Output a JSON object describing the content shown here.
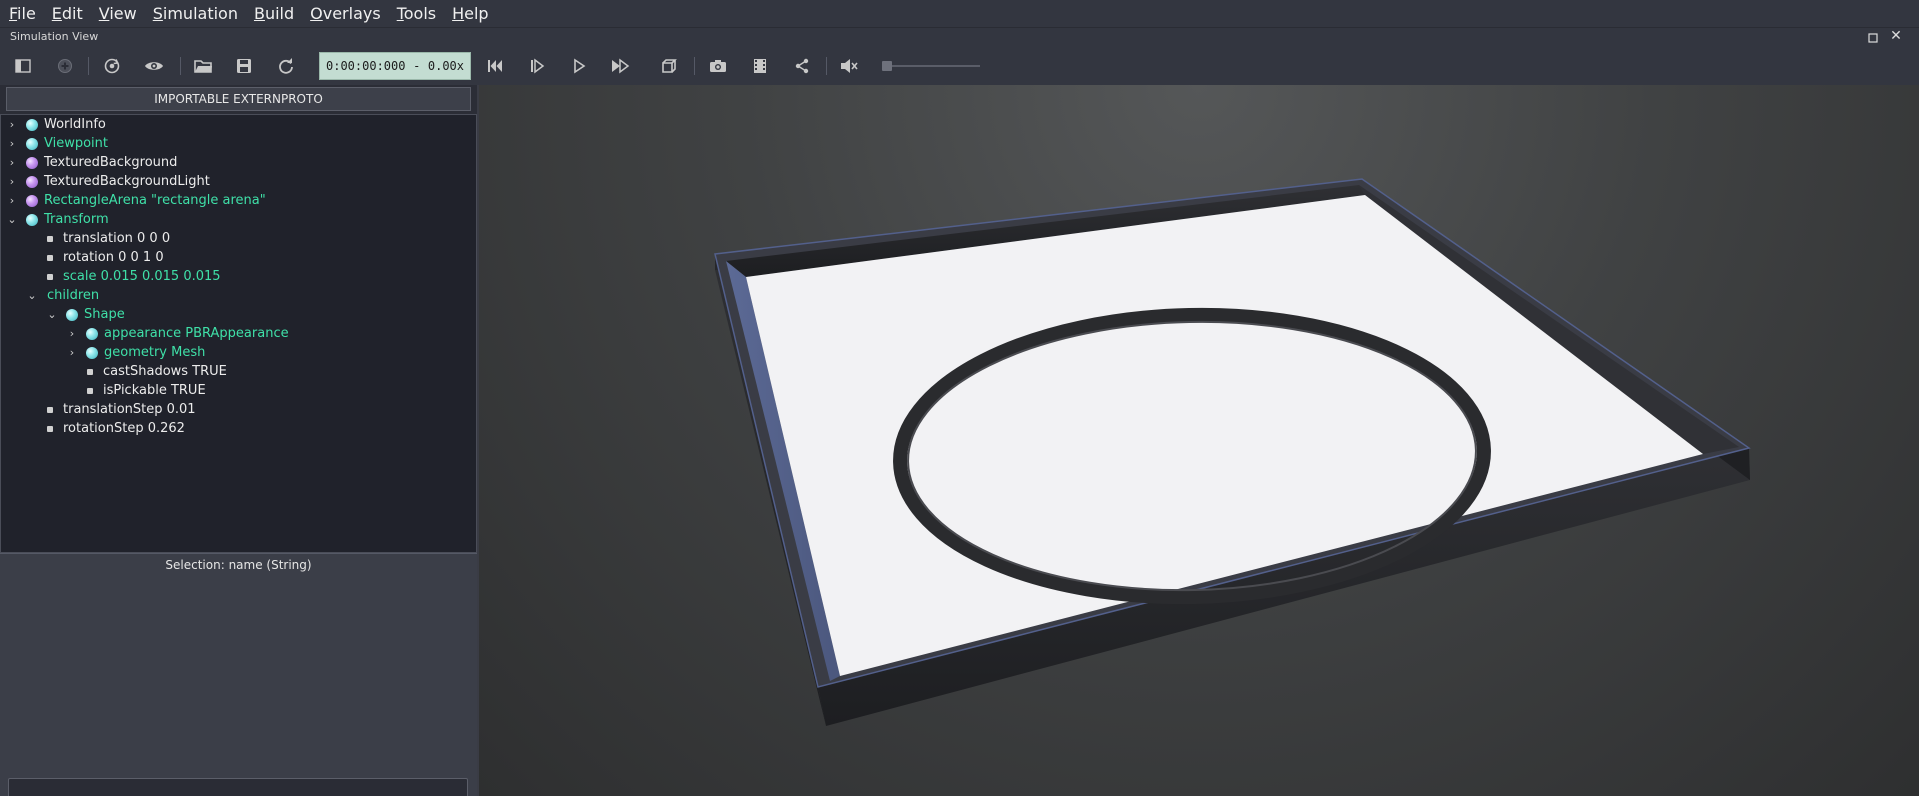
{
  "menu": [
    {
      "mnemonic": "F",
      "rest": "ile"
    },
    {
      "mnemonic": "E",
      "rest": "dit"
    },
    {
      "mnemonic": "V",
      "rest": "iew"
    },
    {
      "mnemonic": "S",
      "rest": "imulation"
    },
    {
      "mnemonic": "B",
      "rest": "uild"
    },
    {
      "mnemonic": "O",
      "rest": "verlays"
    },
    {
      "mnemonic": "T",
      "rest": "ools"
    },
    {
      "mnemonic": "H",
      "rest": "elp"
    }
  ],
  "view_title": "Simulation View",
  "toolbar": {
    "time": "0:00:00:000",
    "separator": "-",
    "speed": "0.00x",
    "volume_level": 0,
    "icons": [
      "toggle-panel-icon",
      "add-node-icon",
      "reset-view-icon",
      "eye-icon",
      "open-folder-icon",
      "save-icon",
      "reload-icon",
      "step-back-icon",
      "step-icon",
      "play-icon",
      "fast-forward-icon",
      "cube-icon",
      "camera-icon",
      "movie-icon",
      "share-icon",
      "mute-icon"
    ]
  },
  "extern_button": "IMPORTABLE EXTERNPROTO",
  "tree": {
    "worldinfo": "WorldInfo",
    "viewpoint": "Viewpoint",
    "texturedbackground": "TexturedBackground",
    "texturedbackgroundlight": "TexturedBackgroundLight",
    "rectanglearena": "RectangleArena \"rectangle arena\"",
    "transform": "Transform",
    "translation": "translation 0 0 0",
    "rotation": "rotation 0 0 1 0",
    "scale": "scale 0.015 0.015 0.015",
    "children": "children",
    "shape": "Shape",
    "appearance": "appearance PBRAppearance",
    "geometry": "geometry Mesh",
    "castshadows": "castShadows TRUE",
    "ispickable": "isPickable TRUE",
    "translationstep": "translationStep 0.01",
    "rotationstep": "rotationStep 0.262"
  },
  "selection_label": "Selection: name (String)",
  "colors": {
    "time_bg": "#c3ddd2",
    "field_green": "#3fe0a8",
    "node_cyan": "#8ee6ea",
    "node_purple": "#c796f0"
  }
}
